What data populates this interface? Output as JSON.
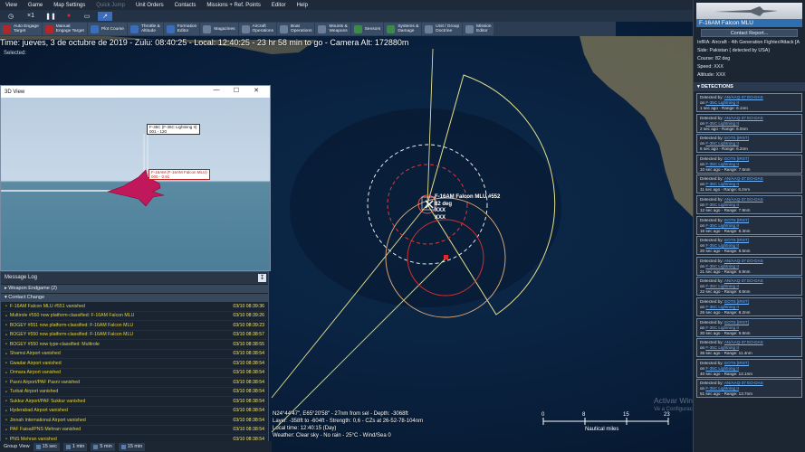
{
  "menu": {
    "items": [
      "View",
      "Game",
      "Map Settings",
      "Quick Jump",
      "Unit Orders",
      "Contacts",
      "Missions + Ref. Points",
      "Editor",
      "Help"
    ]
  },
  "toolbar": {
    "speed_label": "×1"
  },
  "commands": [
    {
      "label": "Auto Engage\nTarget",
      "tone": "red"
    },
    {
      "label": "Manual\nEngage Target",
      "tone": "red"
    },
    {
      "label": "Plot Course",
      "tone": "blue"
    },
    {
      "label": "Throttle &\nAltitude",
      "tone": "blue"
    },
    {
      "label": "Formation\nEditor",
      "tone": "blue"
    },
    {
      "label": "Magazines",
      "tone": "grey"
    },
    {
      "label": "Aircraft\nOperations",
      "tone": "grey"
    },
    {
      "label": "Boat\nOperations",
      "tone": "grey"
    },
    {
      "label": "Mounts &\nWeapons",
      "tone": "grey"
    },
    {
      "label": "Sensors",
      "tone": "green"
    },
    {
      "label": "Systems &\nDamage",
      "tone": "green"
    },
    {
      "label": "Unit / Group\nDoctrine",
      "tone": "grey"
    },
    {
      "label": "Mission\nEditor",
      "tone": "grey"
    }
  ],
  "status": {
    "time_line": "Time: jueves, 3 de octubre de 2019 - Zulu: 08:40:25 - Local: 12:40:25 - 23 hr 58 min to go -  Camera Alt: 172880m",
    "selected": "Selected:"
  },
  "unit_panel": {
    "name": "F-16AM Falcon MLU",
    "contact_button": "Contact Report...",
    "info": [
      "InfRA: Aircraft - 4th Generation Fighter/Attack [A",
      "Side: Pakistan ( detected by USA)",
      "Course: 82 deg",
      "Speed: XXX",
      "Altitude: XXX"
    ]
  },
  "detections": {
    "header": "DETECTIONS",
    "items": [
      {
        "by": "AN/AAQ-37 EO-DAS",
        "on": "F-35C Lightning II",
        "age": "1 sec ago",
        "range": "Range: 6.1nm"
      },
      {
        "by": "AN/AAQ-37 EO-DAS",
        "on": "F-35C Lightning II",
        "age": "2 sec ago",
        "range": "Range: 6.0nm"
      },
      {
        "by": "EOTS [IRST]",
        "on": "F-35C Lightning II",
        "age": "6 sec ago",
        "range": "Range: 6.2nm"
      },
      {
        "by": "EOTS [IRST]",
        "on": "F-35C Lightning II",
        "age": "10 sec ago",
        "range": "Range: 7.5nm"
      },
      {
        "by": "AN/AAQ-37 EO-DAS",
        "on": "F-35C Lightning II",
        "age": "11 sec ago",
        "range": "Range: 6.2nm"
      },
      {
        "by": "AN/AAQ-37 EO-DAS",
        "on": "F-35C Lightning II",
        "age": "12 sec ago",
        "range": "Range: 7.9nm"
      },
      {
        "by": "EOTS [IRST]",
        "on": "F-35C Lightning II",
        "age": "16 sec ago",
        "range": "Range: 6.3nm"
      },
      {
        "by": "EOTS [IRST]",
        "on": "F-35C Lightning II",
        "age": "20 sec ago",
        "range": "Range: 8.5nm"
      },
      {
        "by": "AN/AAQ-37 EO-DAS",
        "on": "F-35C Lightning II",
        "age": "21 sec ago",
        "range": "Range: 6.9nm"
      },
      {
        "by": "AN/AAQ-37 EO-DAS",
        "on": "F-35C Lightning II",
        "age": "22 sec ago",
        "range": "Range: 8.6nm"
      },
      {
        "by": "EOTS [IRST]",
        "on": "F-35C Lightning II",
        "age": "26 sec ago",
        "range": "Range: 8.2nm"
      },
      {
        "by": "EOTS [IRST]",
        "on": "F-35C Lightning II",
        "age": "30 sec ago",
        "range": "Range: 9.9nm"
      },
      {
        "by": "AN/AAQ-37 EO-DAS",
        "on": "F-35C Lightning II",
        "age": "36 sec ago",
        "range": "Range: 11.4nm"
      },
      {
        "by": "EOTS [IRST]",
        "on": "F-35C Lightning II",
        "age": "40 sec ago",
        "range": "Range: 12.1nm"
      },
      {
        "by": "AN/AAQ-37 EO-DAS",
        "on": "F-35C Lightning II",
        "age": "51 sec ago",
        "range": "Range: 13.7nm"
      }
    ]
  },
  "view3d": {
    "title": "3D View",
    "label_blue": "F-35C (F-35C Lightning II)\n001 - 120",
    "label_red": "F-16AM (F-16AM Falcon MLU)\n000 - 0.91"
  },
  "message_log": {
    "title": "Message Log",
    "groups": [
      "Weapon Endgame (2)",
      "Contact Change"
    ],
    "rows": [
      {
        "text": "F-16AM Falcon MLU #551 vanished",
        "time": "03/10 08:39:36"
      },
      {
        "text": "Multirole #550 now platform-classified: F-16AM Falcon MLU",
        "time": "03/10 08:39:26"
      },
      {
        "text": "BOGEY #551 now platform-classified: F-16AM Falcon MLU",
        "time": "03/10 08:39:23"
      },
      {
        "text": "BOGEY #550 now platform-classified: F-16AM Falcon MLU",
        "time": "03/10 08:38:57"
      },
      {
        "text": "BOGEY #550 now type-classified: Multirole",
        "time": "03/10 08:38:55"
      },
      {
        "text": "Shamsi Airport vanished",
        "time": "03/10 08:38:54"
      },
      {
        "text": "Gwadar Airport vanished",
        "time": "03/10 08:38:54"
      },
      {
        "text": "Ormara Airport vanished",
        "time": "03/10 08:38:54"
      },
      {
        "text": "Pasni Airport/PAF Pasni vanished",
        "time": "03/10 08:38:54"
      },
      {
        "text": "Turbat Airport vanished",
        "time": "03/10 08:38:54"
      },
      {
        "text": "Sukkur Airport/PAF Sukkur vanished",
        "time": "03/10 08:38:54"
      },
      {
        "text": "Hyderabad Airport vanished",
        "time": "03/10 08:38:54"
      },
      {
        "text": "Jinnah International Airport vanished",
        "time": "03/10 08:38:54"
      },
      {
        "text": "PAF Faisal/PNS Mehran vanished",
        "time": "03/10 08:38:54"
      },
      {
        "text": "PNS Mehran vanished",
        "time": "03/10 08:38:54"
      }
    ]
  },
  "group_view": {
    "label": "Group View",
    "buttons": [
      "15 sec",
      "1 min",
      "5 min",
      "15 min"
    ]
  },
  "map": {
    "unit_label": "F-16AM Falcon MLU #552",
    "unit_info": [
      "82 deg",
      "XXX",
      "XXX"
    ],
    "bottom_info": [
      "N24°44'47\", E65°20'58\" - 27nm from sel - Depth: -3068ft",
      "Layer: -358ft to -604ft - Strength: 0,6 - CZs at 26-52-78-104nm",
      "Local time: 12:40:15 (Day)",
      "Weather: Clear sky - No rain - 25°C - Wind/Sea 0"
    ],
    "scale_ticks": [
      "0",
      "8",
      "15",
      "23"
    ],
    "scale_unit": "Nautical miles"
  },
  "watermark": {
    "line1": "Activar Windows",
    "line2": "Ve a Configuración para activar Windows."
  }
}
